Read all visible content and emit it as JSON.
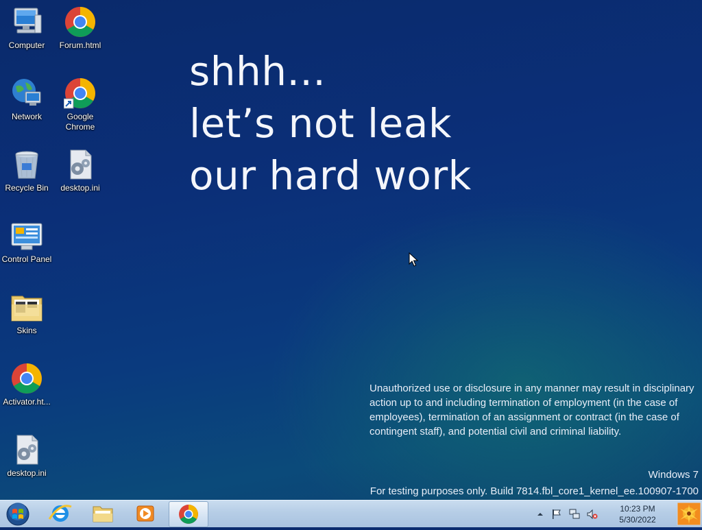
{
  "desktop_icons": [
    {
      "label": "Computer",
      "icon": "computer-icon"
    },
    {
      "label": "Forum.html",
      "icon": "chrome-icon"
    },
    {
      "label": "Network",
      "icon": "network-icon"
    },
    {
      "label": "Google Chrome",
      "icon": "chrome-icon"
    },
    {
      "label": "Recycle Bin",
      "icon": "recycle-bin-icon"
    },
    {
      "label": "desktop.ini",
      "icon": "settings-file-icon"
    },
    {
      "label": "Control Panel",
      "icon": "control-panel-icon"
    },
    {
      "label": "Skins",
      "icon": "folder-icon"
    },
    {
      "label": "Activator.ht...",
      "icon": "chrome-icon"
    },
    {
      "label": "desktop.ini",
      "icon": "settings-file-icon"
    }
  ],
  "wallpaper": {
    "headline": [
      "shhh...",
      "let’s not leak",
      "our hard work"
    ],
    "legal": "Unauthorized use or disclosure in any manner may result in disciplinary action up to and including termination of employment (in the case of employees), termination of an assignment or contract (in the case of contingent staff), and potential civil and criminal liability."
  },
  "watermark": {
    "os": "Windows 7",
    "build": "For testing purposes only. Build 7814.fbl_core1_kernel_ee.100907-1700"
  },
  "taskbar": {
    "pinned": [
      "start-orb-icon",
      "internet-explorer-icon",
      "windows-explorer-icon",
      "media-player-icon",
      "chrome-icon"
    ],
    "tray_icons": [
      "show-hidden-icons-arrow",
      "action-center-flag-icon",
      "network-icon",
      "volume-muted-icon"
    ],
    "clock_time": "10:23 PM",
    "clock_date": "5/30/2022"
  },
  "colors": {
    "wallpaper_top": "#0a2a6b",
    "wallpaper_accent": "#14786e",
    "taskbar": "#b6cde6"
  }
}
